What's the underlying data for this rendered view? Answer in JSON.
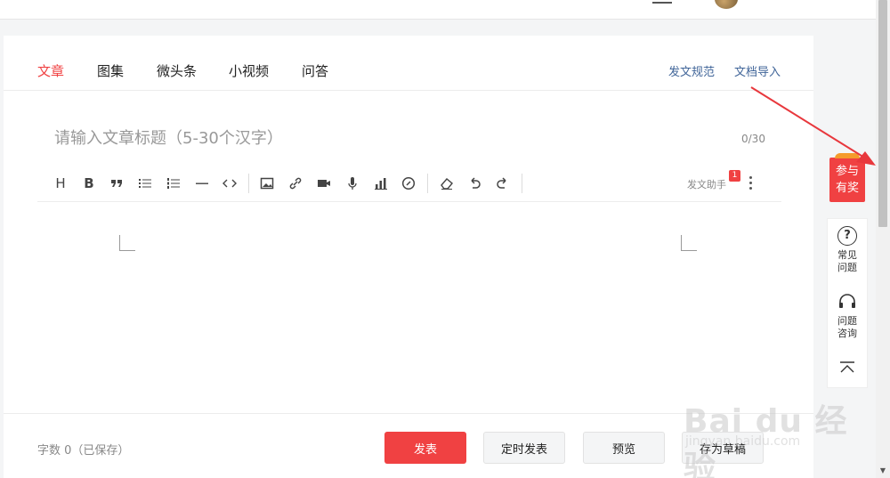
{
  "tabs": [
    {
      "label": "文章",
      "active": true
    },
    {
      "label": "图集"
    },
    {
      "label": "微头条"
    },
    {
      "label": "小视频"
    },
    {
      "label": "问答"
    }
  ],
  "top_links": {
    "rules": "发文规范",
    "import": "文档导入"
  },
  "title_field": {
    "placeholder": "请输入文章标题（5-30个汉字）",
    "value": "",
    "counter": "0/30"
  },
  "toolbar": {
    "tools": [
      "heading-icon",
      "bold-icon",
      "quote-icon",
      "bullet-list-icon",
      "numbered-list-icon",
      "divider-icon",
      "code-icon",
      "image-icon",
      "link-icon",
      "video-icon",
      "audio-icon",
      "chart-icon",
      "embed-icon",
      "eraser-icon",
      "undo-icon",
      "redo-icon"
    ],
    "assistant_label": "发文助手",
    "assistant_badge": "1"
  },
  "footer": {
    "wordcount": "字数 0（已保存）",
    "publish": "发表",
    "schedule": "定时发表",
    "preview": "预览",
    "draft": "存为草稿"
  },
  "sidebar": {
    "promo_line1": "参与",
    "promo_line2": "有奖",
    "faq": "常见问题",
    "consult": "问题咨询"
  },
  "watermark": {
    "brand": "Bai du 经验",
    "url": "jingyan.baidu.com"
  },
  "colors": {
    "accent": "#f04142",
    "link": "#406599",
    "text": "#222222",
    "muted": "#999999"
  }
}
